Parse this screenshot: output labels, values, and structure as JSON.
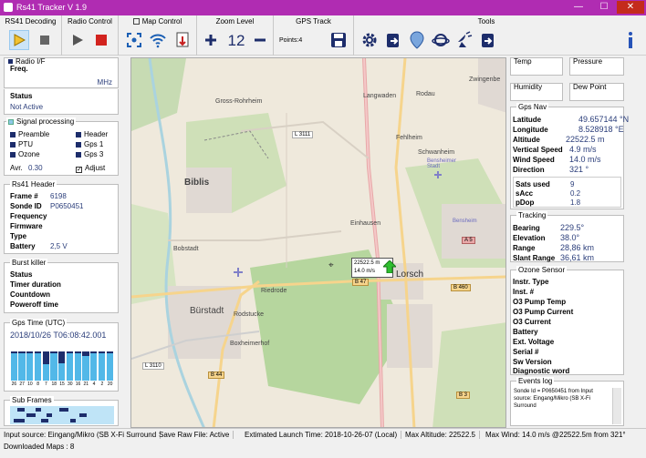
{
  "window": {
    "title": "Rs41 Tracker V 1.9",
    "minimize": "—",
    "maximize": "☐",
    "close": "✕"
  },
  "toolbar": {
    "rs41_decoding": "RS41 Decoding",
    "radio_control": "Radio Control",
    "map_control": "Map Control",
    "zoom_level": "Zoom Level",
    "zoom_value": "12",
    "gps_track": "GPS Track",
    "points": "Points:4",
    "tools": "Tools"
  },
  "radio": {
    "title": "Radio I/F",
    "freq_label": "Freq.",
    "freq_unit": "MHz"
  },
  "status": {
    "label": "Status",
    "value": "Not Active"
  },
  "signal": {
    "title": "Signal processing",
    "preamble": "Preamble",
    "header": "Header",
    "ptu": "PTU",
    "gps1": "Gps 1",
    "ozone": "Ozone",
    "gps3": "Gps 3",
    "avr_label": "Avr.",
    "avr_value": "0.30",
    "adjust": "Adjust"
  },
  "rs41_header": {
    "title": "Rs41 Header",
    "frame_label": "Frame #",
    "frame_value": "6198",
    "sonde_label": "Sonde ID",
    "sonde_value": "P0650451",
    "frequency": "Frequency",
    "firmware": "Firmware",
    "type": "Type",
    "battery_label": "Battery",
    "battery_value": "2,5 V"
  },
  "burst": {
    "title": "Burst killer",
    "status": "Status",
    "timer": "Timer duration",
    "countdown": "Countdown",
    "poweroff": "Poweroff time"
  },
  "gps_time": {
    "title": "Gps Time (UTC)",
    "value": "2018/10/26 T06:08:42.001"
  },
  "sats": {
    "labels": [
      "26",
      "27",
      "10",
      "8",
      "7",
      "18",
      "15",
      "30",
      "16",
      "21",
      "4",
      "2",
      "20"
    ],
    "levels": [
      0.95,
      0.95,
      0.95,
      0.95,
      0.55,
      0.95,
      0.6,
      0.95,
      0.95,
      0.85,
      0.95,
      0.95,
      0.95
    ]
  },
  "sub_frames": {
    "title": "Sub Frames"
  },
  "sensors": {
    "temp": "Temp",
    "pressure": "Pressure",
    "humidity": "Humidity",
    "dew_point": "Dew Point"
  },
  "gps_nav": {
    "title": "Gps Nav",
    "lat_l": "Latitude",
    "lat_v": "49.657144 °N",
    "lon_l": "Longitude",
    "lon_v": "8.528918 °E",
    "alt_l": "Altitude",
    "alt_v": "22522.5 m",
    "vs_l": "Vertical Speed",
    "vs_v": "4.9 m/s",
    "ws_l": "Wind Speed",
    "ws_v": "14.0 m/s",
    "dir_l": "Direction",
    "dir_v": "321 °",
    "sats_l": "Sats used",
    "sats_v": "9",
    "sacc_l": "sAcc",
    "sacc_v": "0.2",
    "pdop_l": "pDop",
    "pdop_v": "1.8"
  },
  "tracking": {
    "title": "Tracking",
    "bearing_l": "Bearing",
    "bearing_v": "229.5°",
    "elev_l": "Elevation",
    "elev_v": "38.0°",
    "range_l": "Range",
    "range_v": "28,86 km",
    "slant_l": "Slant Range",
    "slant_v": "36,61 km"
  },
  "ozone": {
    "title": "Ozone Sensor",
    "items": [
      "Instr. Type",
      "Inst. #",
      "O3 Pump Temp",
      "O3 Pump Current",
      "O3 Current",
      "Battery",
      "Ext. Voltage",
      "Serial #",
      "Sw Version",
      "Diagnostic word"
    ]
  },
  "events": {
    "title": "Events log",
    "text": "Sonde Id = P0650451 from Input source: Eingang/Mikro (SB X-Fi Surround"
  },
  "map": {
    "places": [
      "Biblis",
      "Gross-Rohrheim",
      "Langwaden",
      "Rodau",
      "Zwingenbe",
      "Fehlheim",
      "Schwanheim",
      "Bensheimer Stadt",
      "Einhausen",
      "Lorsch",
      "Bobstadt",
      "Riedrode",
      "Bürstadt",
      "Rodstucke",
      "Boxheimerhof",
      "Bensheim"
    ],
    "roads": [
      "L 3111",
      "L 3110",
      "B 47",
      "B 460",
      "B 44",
      "A 5",
      "B 3"
    ],
    "sonde_alt": "22522.5 m",
    "sonde_speed": "14.0 m/s"
  },
  "statusbar": {
    "input": "Input source: Eingang/Mikro (SB X-Fi Surround",
    "save": "Save Raw File: Active",
    "launch": "Extimated Launch Time: 2018-10-26-07 (Local)",
    "max_alt": "Max Altitude: 22522.5",
    "max_wind": "Max Wind: 14.0 m/s @22522.5m from 321°",
    "maps": "Downloaded Maps : 8"
  }
}
